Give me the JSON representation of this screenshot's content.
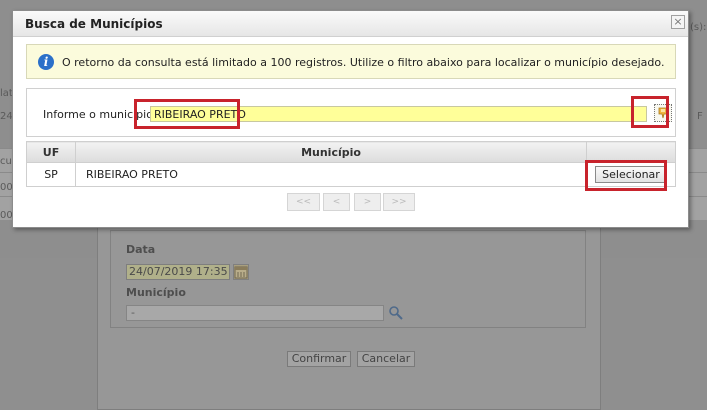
{
  "background": {
    "fragments": [
      "(s):",
      "lat",
      "24/",
      "cu",
      "00",
      "00",
      "F"
    ],
    "form": {
      "date_label": "Data",
      "date_value": "24/07/2019 17:35",
      "municipio_label": "Município",
      "municipio_value": "-",
      "confirm_label": "Confirmar",
      "cancel_label": "Cancelar"
    }
  },
  "modal": {
    "title": "Busca de Municípios",
    "close_glyph": "×",
    "info_icon_glyph": "i",
    "info_text": "O retorno da consulta está limitado a 100 registros. Utilize o filtro abaixo para localizar o município desejado.",
    "filter": {
      "label": "Informe o município",
      "value": "RIBEIRAO PRETO"
    },
    "table": {
      "headers": {
        "uf": "UF",
        "municipio": "Município",
        "acao": ""
      },
      "rows": [
        {
          "uf": "SP",
          "municipio": "RIBEIRAO PRETO",
          "action_label": "Selecionar"
        }
      ]
    },
    "pager": {
      "first": "<<",
      "prev": "<",
      "next": ">",
      "last": ">>"
    }
  },
  "colors": {
    "highlight": "#c8232c",
    "input_yellow": "#ffff99",
    "info_background": "#fbfbdc",
    "info_icon": "#2b70c9"
  },
  "icons": {
    "filter_button": "filter-icon",
    "info": "info-icon",
    "calendar": "calendar-icon",
    "search": "magnifier-icon",
    "close": "close-icon"
  }
}
